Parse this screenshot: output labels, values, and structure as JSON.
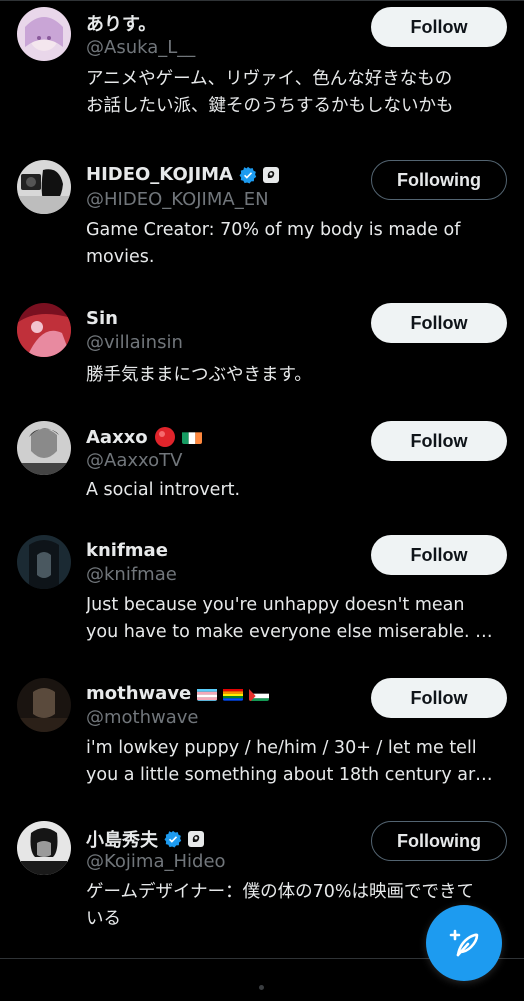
{
  "accounts": [
    {
      "name": "ありす。",
      "handle": "@Asuka_L__",
      "bio": [
        "アニメやゲーム、リヴァイ、色んな好きなもの",
        "お話したい派、鍵そのうちするかもしないかも"
      ],
      "button": "Follow",
      "state": "follow"
    },
    {
      "name": "HIDEO_KOJIMA",
      "handle": "@HIDEO_KOJIMA_EN",
      "bio": [
        "Game Creator: 70% of my body is made of",
        "movies."
      ],
      "button": "Following",
      "state": "following"
    },
    {
      "name": "Sin",
      "handle": "@villainsin",
      "bio": [
        "勝手気ままにつぶやきます。"
      ],
      "button": "Follow",
      "state": "follow"
    },
    {
      "name": "Aaxxo",
      "handle": "@AaxxoTV",
      "bio": [
        "A social introvert."
      ],
      "button": "Follow",
      "state": "follow"
    },
    {
      "name": "knifmae",
      "handle": "@knifmae",
      "bio": [
        "Just because you're unhappy doesn't mean",
        "you have to make everyone else miserable. …"
      ],
      "button": "Follow",
      "state": "follow"
    },
    {
      "name": "mothwave",
      "handle": "@mothwave",
      "bio": [
        "i'm lowkey puppy / he/him / 30+ / let me tell",
        "you a little something about 18th century ar…"
      ],
      "button": "Follow",
      "state": "follow"
    },
    {
      "name": "小島秀夫",
      "handle": "@Kojima_Hideo",
      "bio": [
        "ゲームデザイナー：僕の体の70%は映画でできて",
        "いる"
      ],
      "button": "Following",
      "state": "following"
    }
  ],
  "colors": {
    "accent": "#1d9bf0",
    "muted": "#71767b",
    "background": "#000000"
  },
  "icons": {
    "verified": "verified-badge-icon",
    "affiliate": "affiliate-badge-icon",
    "compose": "compose-post-icon"
  }
}
